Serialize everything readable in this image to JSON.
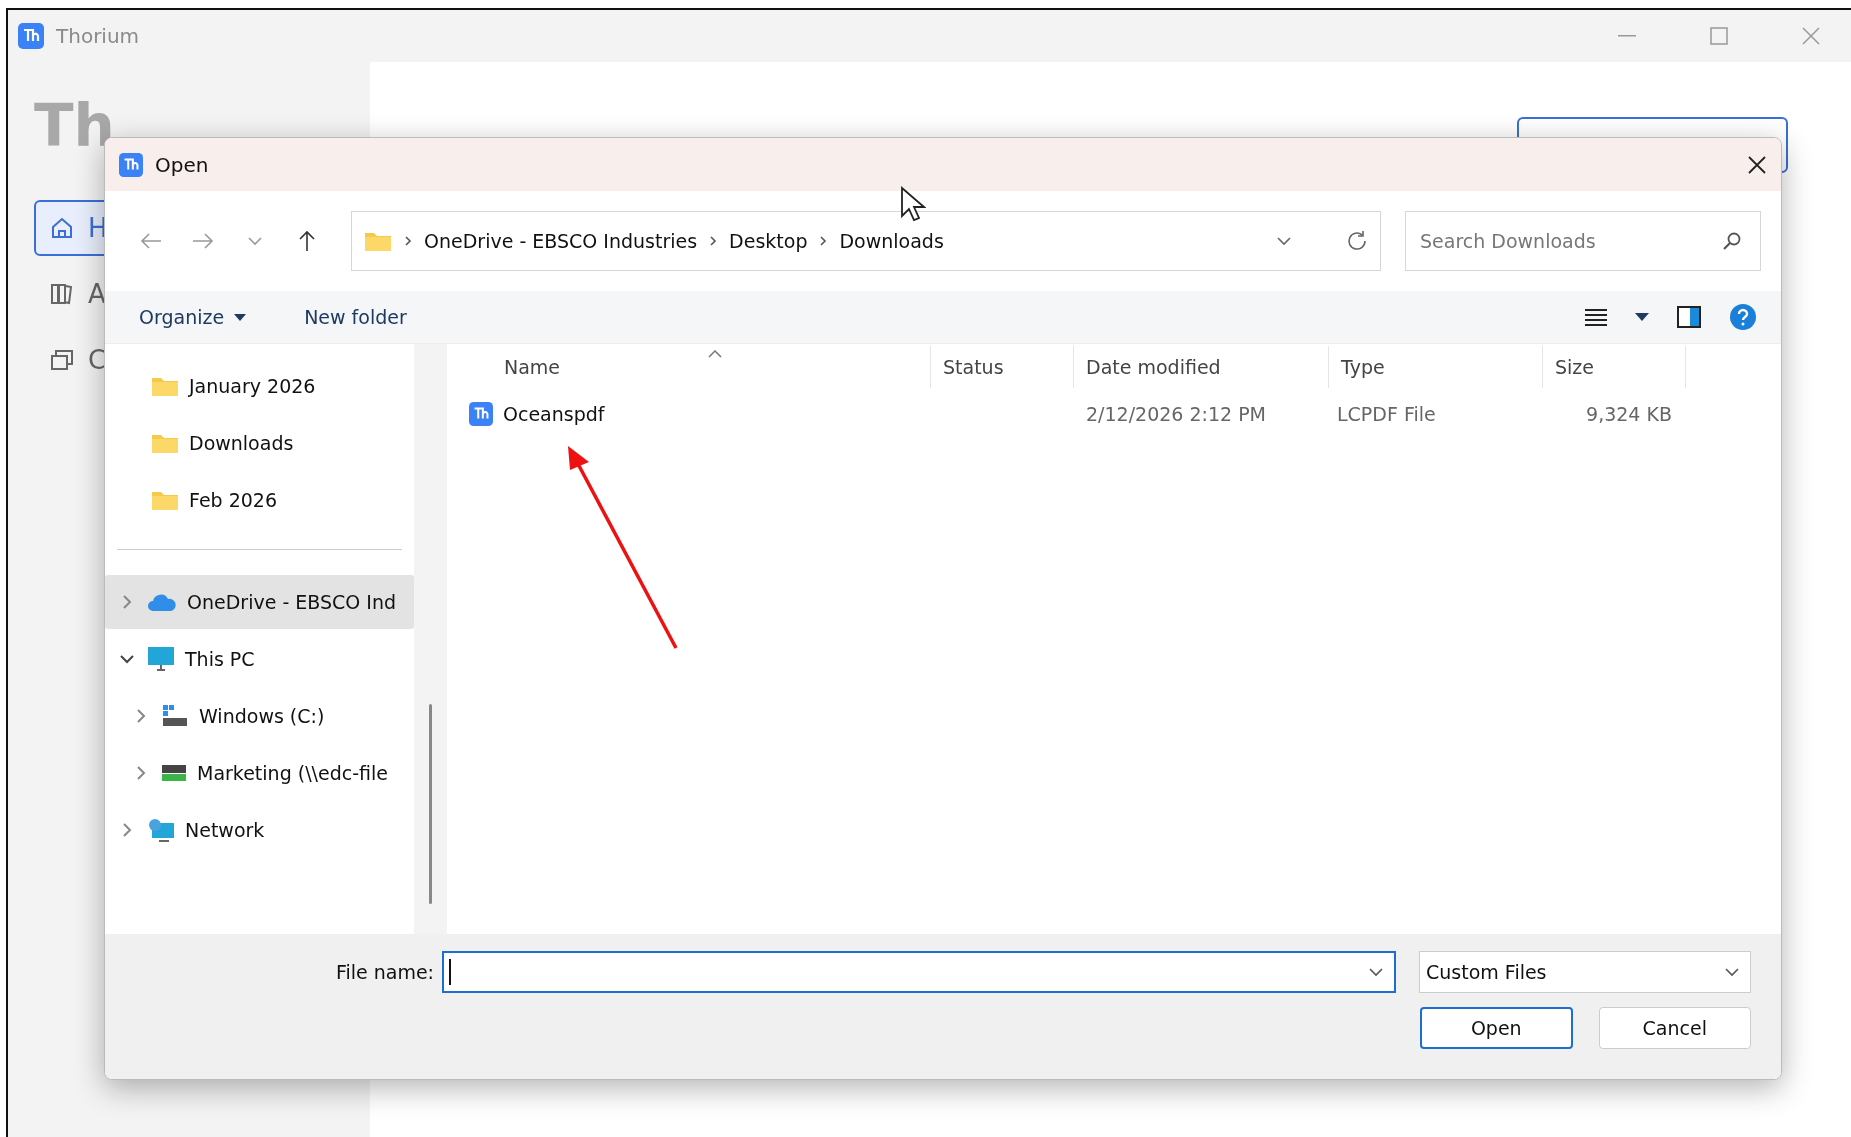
{
  "app": {
    "title": "Thorium",
    "heading": "Th",
    "nav": [
      {
        "label": "H",
        "kind": "home",
        "selected": true
      },
      {
        "label": "A",
        "kind": "books",
        "selected": false
      },
      {
        "label": "C",
        "kind": "windows",
        "selected": false
      }
    ]
  },
  "dialog": {
    "title": "Open",
    "breadcrumb": [
      "OneDrive - EBSCO Industries",
      "Desktop",
      "Downloads"
    ],
    "search": {
      "placeholder": "Search Downloads"
    },
    "toolbar": {
      "organize": "Organize",
      "new_folder": "New folder"
    },
    "quick_access": [
      "January 2026",
      "Downloads",
      "Feb 2026"
    ],
    "tree": [
      {
        "label": "OneDrive - EBSCO Ind",
        "kind": "cloud",
        "expanded": false,
        "selected": true
      },
      {
        "label": "This PC",
        "kind": "pc",
        "expanded": true,
        "selected": false,
        "children": [
          {
            "label": "Windows (C:)",
            "kind": "drive",
            "expanded": false,
            "selected": false
          },
          {
            "label": "Marketing (\\\\edc-file",
            "kind": "netdrive",
            "expanded": false,
            "selected": false
          }
        ]
      },
      {
        "label": "Network",
        "kind": "network",
        "expanded": false,
        "selected": false
      }
    ],
    "columns": [
      {
        "label": "Name",
        "sorted": true
      },
      {
        "label": "Status",
        "sorted": false
      },
      {
        "label": "Date modified",
        "sorted": false
      },
      {
        "label": "Type",
        "sorted": false
      },
      {
        "label": "Size",
        "sorted": false
      }
    ],
    "files": [
      {
        "name": "Oceanspdf",
        "date": "2/12/2026 2:12 PM",
        "type": "LCPDF File",
        "size": "9,324 KB",
        "selected": false
      }
    ],
    "file_name_label": "File name:",
    "file_type": "Custom Files",
    "buttons": [
      {
        "label": "Open",
        "kind": "primary"
      },
      {
        "label": "Cancel",
        "kind": "secondary"
      }
    ]
  }
}
